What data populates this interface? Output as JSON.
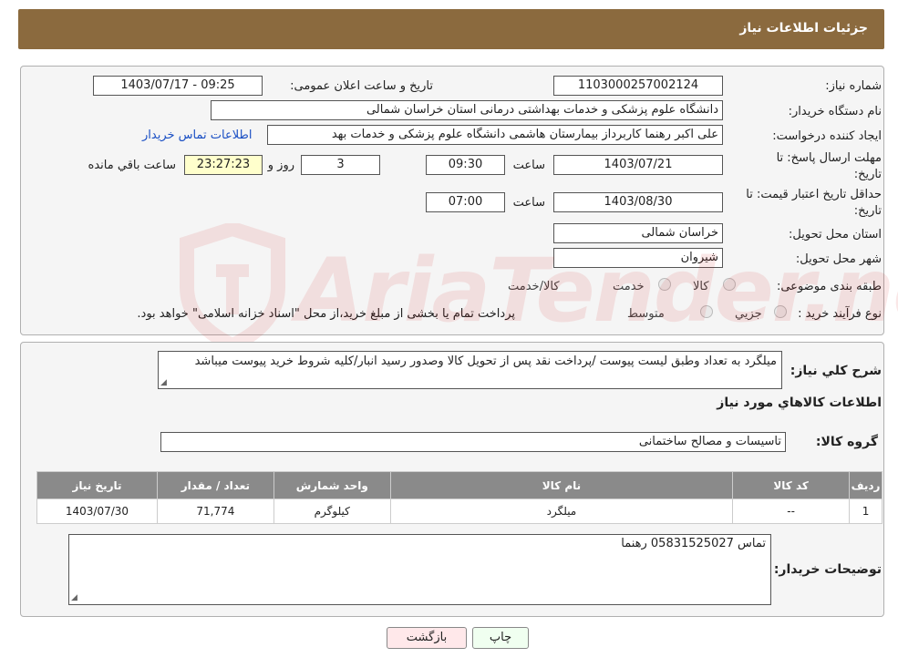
{
  "header": {
    "title": "جزئیات اطلاعات نیاز"
  },
  "form": {
    "need_number_label": "شماره نیاز:",
    "need_number": "1103000257002124",
    "announce_label": "تاریخ و ساعت اعلان عمومی:",
    "announce_value": "1403/07/17 - 09:25",
    "buyer_org_label": "نام دستگاه خریدار:",
    "buyer_org": "دانشگاه علوم پزشکی و خدمات بهداشتی درمانی استان خراسان شمالی",
    "requester_label": "ایجاد کننده درخواست:",
    "requester": "علی اکبر رهنما کاربرداز بیمارستان هاشمی دانشگاه علوم پزشکی و خدمات بهد",
    "contact_link": "اطلاعات تماس خریدار",
    "deadline_label_1": "مهلت ارسال پاسخ: تا",
    "deadline_label_2": "تاریخ:",
    "deadline_date": "1403/07/21",
    "time_label": "ساعت",
    "deadline_time": "09:30",
    "days_value": "3",
    "days_label": "روز و",
    "remaining_value": "23:27:23",
    "remaining_label": "ساعت باقي مانده",
    "validity_label_1": "حداقل تاریخ اعتبار قیمت: تا",
    "validity_label_2": "تاریخ:",
    "validity_date": "1403/08/30",
    "validity_time": "07:00",
    "province_label": "استان محل تحویل:",
    "province": "خراسان شمالی",
    "city_label": "شهر محل تحویل:",
    "city": "شیروان",
    "category_label": "طبقه بندی موضوعی:",
    "category_options": [
      "کالا",
      "خدمت",
      "کالا/خدمت"
    ],
    "process_label": "نوع فرآیند خرید :",
    "process_options": [
      "جزیي",
      "متوسط"
    ],
    "process_note": "پرداخت تمام یا بخشی از مبلغ خرید،از محل \"اسناد خزانه اسلامی\" خواهد بود."
  },
  "details": {
    "summary_label": "شرح كلي نياز:",
    "summary": "میلگرد به تعداد وطبق لیست پیوست /پرداخت نقد پس از تحویل کالا وصدور رسید انبار/کلیه شروط خرید پیوست میباشد",
    "items_heading": "اطلاعات کالاهاي مورد نياز",
    "group_label": "گروه کالا:",
    "group_value": "تاسیسات و مصالح ساختمانی",
    "table": {
      "headers": [
        "رديف",
        "کد کالا",
        "نام کالا",
        "واحد شمارش",
        "تعداد / مقدار",
        "تاریخ نیاز"
      ],
      "rows": [
        [
          "1",
          "--",
          "میلگرد",
          "کیلوگرم",
          "71,774",
          "1403/07/30"
        ]
      ]
    },
    "buyer_notes_label": "توضیحات خریدار:",
    "buyer_notes": "تماس 05831525027 رهنما"
  },
  "buttons": {
    "print": "چاپ",
    "back": "بازگشت"
  },
  "watermark": {
    "text": "AriaTender.neT"
  },
  "colors": {
    "header": "#8b6a3e",
    "link": "#1a4fc4",
    "table_header": "#8a8a8a"
  }
}
